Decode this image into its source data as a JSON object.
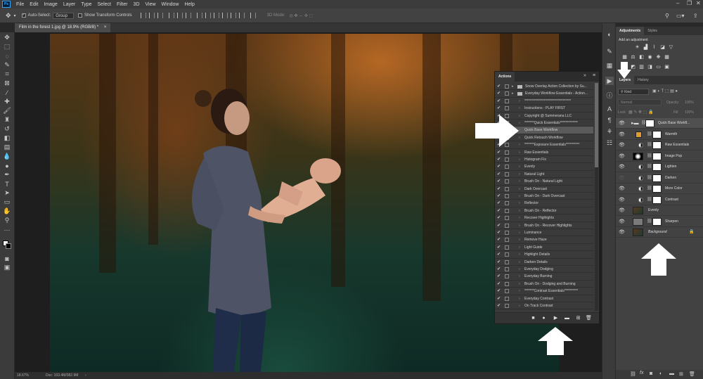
{
  "menu": {
    "logo": "Ps",
    "items": [
      "File",
      "Edit",
      "Image",
      "Layer",
      "Type",
      "Select",
      "Filter",
      "3D",
      "View",
      "Window",
      "Help"
    ]
  },
  "options_bar": {
    "auto_select_label": "Auto-Select:",
    "auto_select_value": "Group",
    "transform_label": "Show Transform Controls",
    "mode_label": "3D Mode:"
  },
  "document": {
    "tab_title": "Film in the forest 1.jpg @ 18.9% (RGB/8) *",
    "close": "×"
  },
  "status": {
    "zoom": "18.67%",
    "doc_size": "Doc: 103.4M/382.9M"
  },
  "adjustments_panel": {
    "tabs": [
      "Adjustments",
      "Styles"
    ],
    "heading": "Add an adjustment"
  },
  "layers_panel": {
    "tabs": [
      "Layers",
      "History"
    ],
    "filter_value": "Kind",
    "blend_mode": "Normal",
    "opacity_label": "Opacity:",
    "opacity_value": "100%",
    "lock_label": "Lock:",
    "fill_label": "Fill:",
    "fill_value": "100%",
    "layers": [
      {
        "name": "Quick Base Workfl...",
        "kind": "group",
        "selected": true,
        "visible": true
      },
      {
        "name": "Warmth",
        "kind": "color",
        "visible": true
      },
      {
        "name": "Raw Essentials",
        "kind": "adjust",
        "visible": true
      },
      {
        "name": "Image Pop",
        "kind": "adjust-dark",
        "visible": true
      },
      {
        "name": "Lighten",
        "kind": "adjust",
        "visible": true
      },
      {
        "name": "Darken",
        "kind": "adjust",
        "visible": false
      },
      {
        "name": "More Color",
        "kind": "adjust",
        "visible": true
      },
      {
        "name": "Contrast",
        "kind": "adjust",
        "visible": true
      },
      {
        "name": "Evenly",
        "kind": "photo",
        "visible": true
      },
      {
        "name": "Sharpen",
        "kind": "gray",
        "visible": true
      },
      {
        "name": "Background",
        "kind": "background",
        "visible": true
      }
    ]
  },
  "actions_panel": {
    "tab": "Actions",
    "menu_glyph": "≡",
    "collapse_glyph": "»",
    "rows": [
      {
        "name": "Snow Overlay Action Collection by Su...",
        "type": "set",
        "checked": true
      },
      {
        "name": "Everyday Workflow Essentials - Action...",
        "type": "set",
        "checked": true
      },
      {
        "name": "**********************************",
        "type": "action",
        "checked": true
      },
      {
        "name": "Instructions - PLAY FIRST",
        "type": "action",
        "checked": true
      },
      {
        "name": "Copyright @ Summerana LLC",
        "type": "action",
        "checked": true
      },
      {
        "name": "*******Quick Essentials*************",
        "type": "action",
        "checked": true
      },
      {
        "name": "Quick Base Workflow",
        "type": "action",
        "checked": true,
        "selected": true
      },
      {
        "name": "Quick Retouch Workflow",
        "type": "action",
        "checked": true
      },
      {
        "name": "*******Exposure Essentials**********",
        "type": "action",
        "checked": true
      },
      {
        "name": "Raw Essentials",
        "type": "action",
        "checked": true
      },
      {
        "name": "Histogram Fix",
        "type": "action",
        "checked": true
      },
      {
        "name": "Evenly",
        "type": "action",
        "checked": true
      },
      {
        "name": "Natural Light",
        "type": "action",
        "checked": true
      },
      {
        "name": "Brush On - Natural Light",
        "type": "action",
        "checked": true
      },
      {
        "name": "Dark Overcast",
        "type": "action",
        "checked": true
      },
      {
        "name": "Brush On - Dark Overcast",
        "type": "action",
        "checked": true
      },
      {
        "name": "Reflector",
        "type": "action",
        "checked": true
      },
      {
        "name": "Brush On - Reflector",
        "type": "action",
        "checked": true
      },
      {
        "name": "Recover Highlights",
        "type": "action",
        "checked": true
      },
      {
        "name": "Brush On - Recover Highlights",
        "type": "action",
        "checked": true
      },
      {
        "name": "Luminance",
        "type": "action",
        "checked": true
      },
      {
        "name": "Remove Haze",
        "type": "action",
        "checked": true
      },
      {
        "name": "Light Guide",
        "type": "action",
        "checked": true
      },
      {
        "name": "Highlight Details",
        "type": "action",
        "checked": true
      },
      {
        "name": "Darken Details",
        "type": "action",
        "checked": true
      },
      {
        "name": "Everyday Dodging",
        "type": "action",
        "checked": true
      },
      {
        "name": "Everyday Burning",
        "type": "action",
        "checked": true
      },
      {
        "name": "Brush On - Dodging and Burning",
        "type": "action",
        "checked": true
      },
      {
        "name": "*******Contrast Essentials**********",
        "type": "action",
        "checked": true
      },
      {
        "name": "Everyday Contrast",
        "type": "action",
        "checked": true
      },
      {
        "name": "On Track Contrast",
        "type": "action",
        "checked": true
      }
    ]
  },
  "colors": {
    "arrow": "#ffffff",
    "selection": "#5a5a5a",
    "accent": "#31a8ff"
  }
}
